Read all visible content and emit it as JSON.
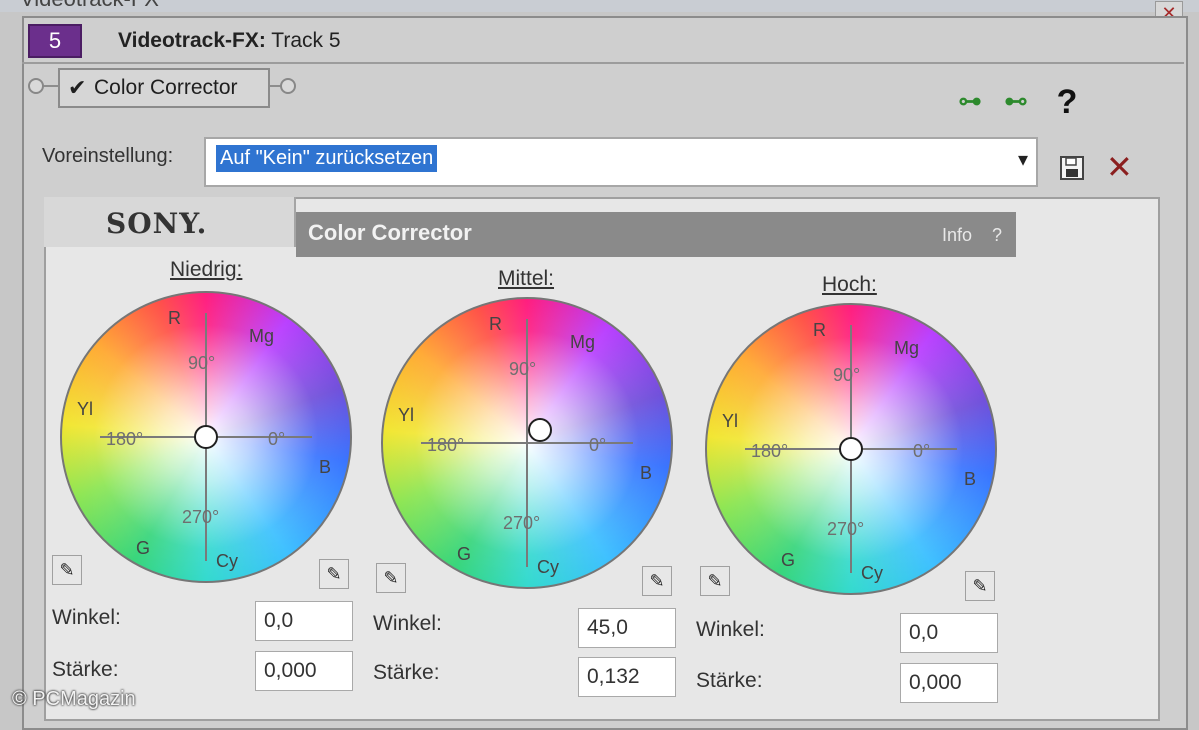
{
  "window": {
    "title": "Videotrack-FX"
  },
  "track": {
    "number": "5",
    "title_bold": "Videotrack-FX:",
    "title_rest": " Track 5"
  },
  "plugin_chain": {
    "plugin_label": "Color Corrector",
    "check": "✔"
  },
  "toolbar": {
    "question": "?"
  },
  "preset": {
    "label": "Voreinstellung:",
    "value": "Auf \"Kein\" zurücksetzen"
  },
  "panel": {
    "brand": "SONY.",
    "title": "Color Corrector",
    "info": "Info",
    "help": "?"
  },
  "wheels": [
    {
      "title": "Niedrig:",
      "winkel_label": "Winkel:",
      "winkel_value": "0,0",
      "staerke_label": "Stärke:",
      "staerke_value": "0,000",
      "angle_deg": 0,
      "magnitude": 0.0,
      "labels": {
        "r": "R",
        "mg": "Mg",
        "yl": "Yl",
        "b": "B",
        "g": "G",
        "cy": "Cy",
        "deg90": "90°",
        "deg180": "180°",
        "deg0": "0°",
        "deg270": "270°"
      }
    },
    {
      "title": "Mittel:",
      "winkel_label": "Winkel:",
      "winkel_value": "45,0",
      "staerke_label": "Stärke:",
      "staerke_value": "0,132",
      "angle_deg": 45.0,
      "magnitude": 0.132,
      "labels": {
        "r": "R",
        "mg": "Mg",
        "yl": "Yl",
        "b": "B",
        "g": "G",
        "cy": "Cy",
        "deg90": "90°",
        "deg180": "180°",
        "deg0": "0°",
        "deg270": "270°"
      }
    },
    {
      "title": "Hoch:",
      "winkel_label": "Winkel:",
      "winkel_value": "0,0",
      "staerke_label": "Stärke:",
      "staerke_value": "0,000",
      "angle_deg": 0,
      "magnitude": 0.0,
      "labels": {
        "r": "R",
        "mg": "Mg",
        "yl": "Yl",
        "b": "B",
        "g": "G",
        "cy": "Cy",
        "deg90": "90°",
        "deg180": "180°",
        "deg0": "0°",
        "deg270": "270°"
      }
    }
  ],
  "watermark": "© PCMagazin"
}
